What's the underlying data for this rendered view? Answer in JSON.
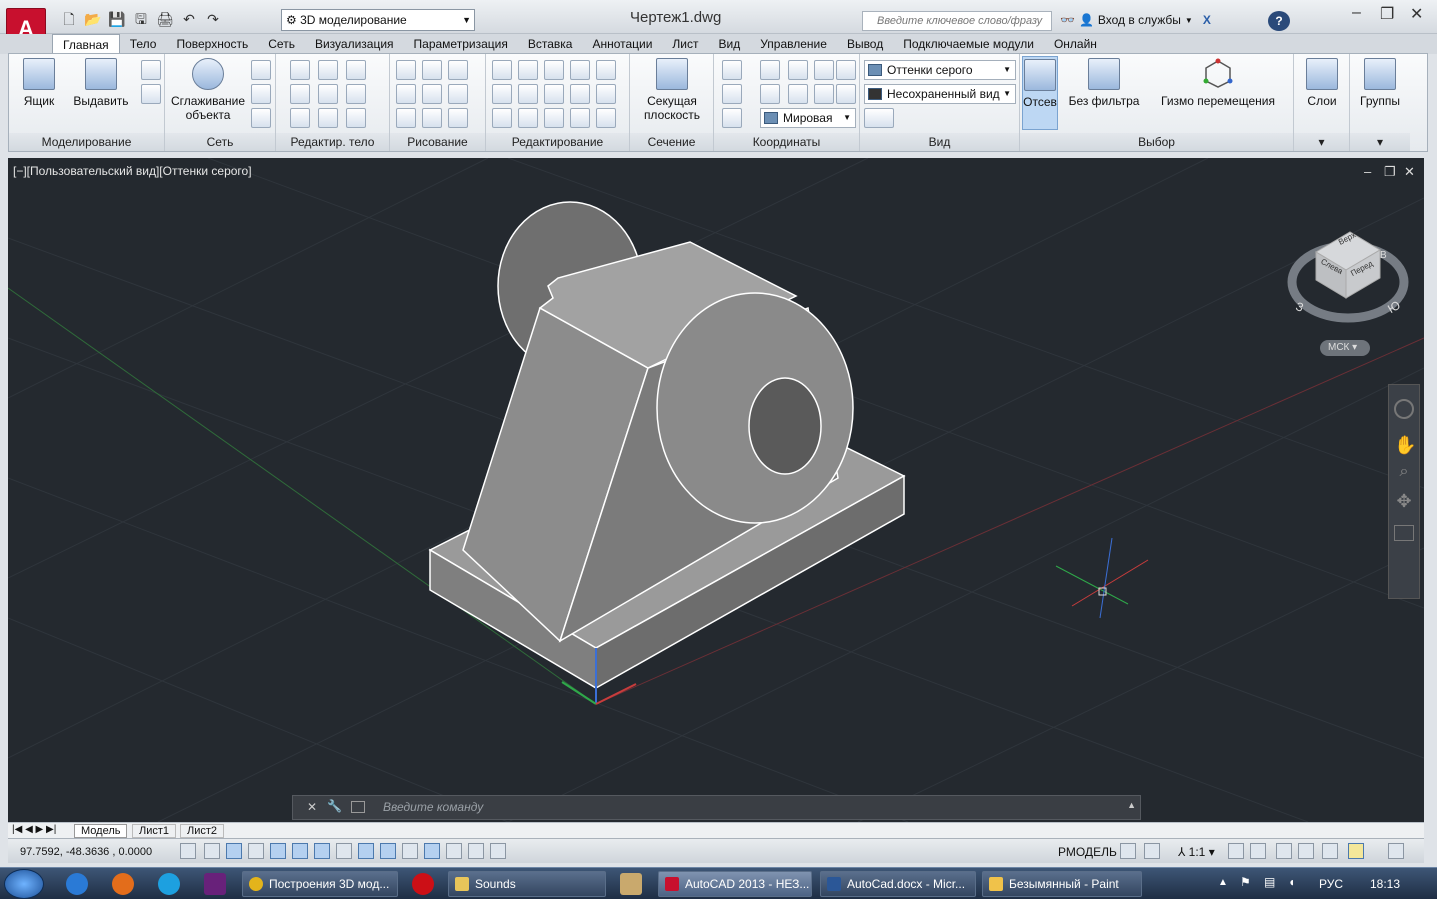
{
  "app": {
    "doc_title": "Чертеж1.dwg",
    "workspace": "3D моделирование",
    "search_placeholder": "Введите ключевое слово/фразу",
    "login": "Вход в службы"
  },
  "tabs": [
    "Главная",
    "Тело",
    "Поверхность",
    "Сеть",
    "Визуализация",
    "Параметризация",
    "Вставка",
    "Аннотации",
    "Лист",
    "Вид",
    "Управление",
    "Вывод",
    "Подключаемые модули",
    "Онлайн"
  ],
  "ribbon": {
    "box_label": "Ящик",
    "extrude_label": "Выдавить",
    "modeling_title": "Моделирование",
    "smooth_label_1": "Сглаживание",
    "smooth_label_2": "объекта",
    "mesh_title": "Сеть",
    "solid_edit_title": "Редактир. тело",
    "draw_title": "Рисование",
    "modify_title": "Редактирование",
    "section_label_1": "Секущая",
    "section_label_2": "плоскость",
    "section_title": "Сечение",
    "coords_title": "Координаты",
    "coords_world": "Мировая",
    "visual_style": "Оттенки серого",
    "named_view": "Несохраненный вид",
    "view_title": "Вид",
    "culling_label": "Отсев",
    "no_filter_label": "Без фильтра",
    "gizmo_label": "Гизмо перемещения",
    "selection_title": "Выбор",
    "layers_label": "Слои",
    "groups_label": "Группы"
  },
  "viewport": {
    "label": "[−][Пользовательский вид][Оттенки серого]",
    "viewcube_top": "Верх",
    "viewcube_left": "Слева",
    "viewcube_front": "Перед",
    "compass_w": "З",
    "compass_s": "Ю",
    "compass_e": "В",
    "ucs_label": "МСК"
  },
  "command": {
    "placeholder": "Введите команду"
  },
  "layout_tabs": [
    "Модель",
    "Лист1",
    "Лист2"
  ],
  "status": {
    "coords": "97.7592,  -48.3636 , 0.0000",
    "model_label": "РМОДЕЛЬ",
    "scale": "1:1"
  },
  "taskbar": {
    "items": [
      "Построения 3D мод...",
      "Sounds",
      "AutoCAD 2013 - НЕЗ...",
      "AutoCad.docx - Micr...",
      "Безымянный - Paint"
    ],
    "lang": "РУС",
    "clock": "18:13"
  },
  "colors": {
    "accent_red": "#c8102e",
    "viewport_bg": "#24292f"
  }
}
